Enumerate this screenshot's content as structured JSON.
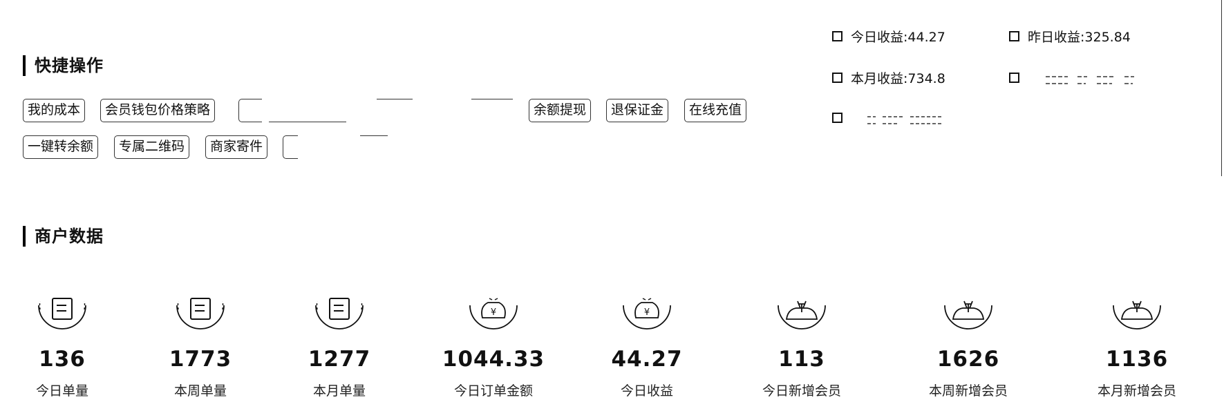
{
  "quick_ops": {
    "title": "快捷操作",
    "row1": [
      {
        "label": "我的成本"
      },
      {
        "label": "会员钱包价格策略"
      },
      {
        "label": ""
      },
      {
        "label": "余额提现"
      },
      {
        "label": "退保证金"
      },
      {
        "label": "在线充值"
      }
    ],
    "row2": [
      {
        "label": "一键转余额"
      },
      {
        "label": "专属二维码"
      },
      {
        "label": "商家寄件"
      },
      {
        "label": ""
      }
    ]
  },
  "earnings": {
    "today": "今日收益:44.27",
    "yesterday": "昨日收益:325.84",
    "month": "本月收益:734.8"
  },
  "merchant": {
    "title": "商户数据",
    "metrics": [
      {
        "value": "136",
        "label": "今日单量",
        "icon": "order-icon"
      },
      {
        "value": "1773",
        "label": "本周单量",
        "icon": "order-icon"
      },
      {
        "value": "1277",
        "label": "本月单量",
        "icon": "order-icon"
      },
      {
        "value": "1044.33",
        "label": "今日订单金额",
        "icon": "yen-bag-icon"
      },
      {
        "value": "44.27",
        "label": "今日收益",
        "icon": "yen-bag-icon"
      },
      {
        "value": "113",
        "label": "今日新增会员",
        "icon": "member-icon"
      },
      {
        "value": "1626",
        "label": "本周新增会员",
        "icon": "member-icon"
      },
      {
        "value": "1136",
        "label": "本月新增会员",
        "icon": "member-icon"
      }
    ]
  }
}
